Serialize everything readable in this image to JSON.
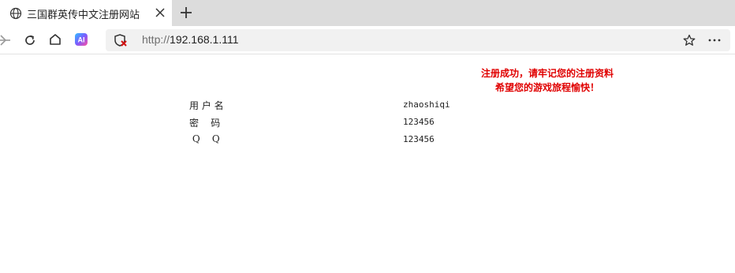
{
  "browser": {
    "tab_title": "三国群英传中文注册网站",
    "url_scheme": "http://",
    "url_host": "192.168.1.111"
  },
  "icons": {
    "tab": "globe-icon",
    "close": "close-icon",
    "new_tab": "plus-icon",
    "back": "arrow-left-icon",
    "reload": "reload-icon",
    "home": "home-icon",
    "ai": "ai-icon",
    "security": "shield-x-icon",
    "favorite": "star-icon",
    "more": "more-icon"
  },
  "page": {
    "message_line1": "注册成功，请牢记您的注册资料",
    "message_line2": "希望您的游戏旅程愉快！",
    "message_color": "#e00000",
    "rows": [
      {
        "label": "用 户 名",
        "value": "zhaoshiqi"
      },
      {
        "label": "密    码",
        "value": "123456"
      },
      {
        "label": " Q    Q",
        "value": "123456"
      }
    ]
  }
}
